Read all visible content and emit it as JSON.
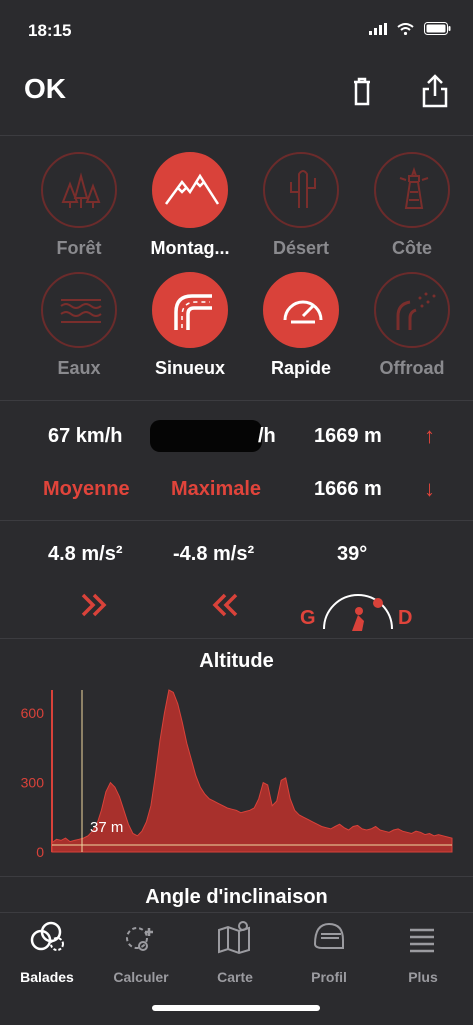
{
  "status": {
    "time": "18:15"
  },
  "header": {
    "title": "OK"
  },
  "categories": [
    {
      "label": "Forêt",
      "icon": "trees-icon",
      "active": false
    },
    {
      "label": "Montag...",
      "icon": "mountain-icon",
      "active": true
    },
    {
      "label": "Désert",
      "icon": "cactus-icon",
      "active": false
    },
    {
      "label": "Côte",
      "icon": "lighthouse-icon",
      "active": false
    },
    {
      "label": "Eaux",
      "icon": "waves-icon",
      "active": false
    },
    {
      "label": "Sinueux",
      "icon": "winding-road-icon",
      "active": true
    },
    {
      "label": "Rapide",
      "icon": "speedometer-icon",
      "active": true
    },
    {
      "label": "Offroad",
      "icon": "offroad-icon",
      "active": false
    }
  ],
  "stats": {
    "avg_speed": "67 km/h",
    "max_speed_suffix": "/h",
    "altitude_max": "1669 m",
    "avg_label": "Moyenne",
    "max_label": "Maximale",
    "altitude_min": "1666 m",
    "accel": "4.8 m/s²",
    "decel": "-4.8 m/s²",
    "lean_angle": "39°",
    "lean_left": "G",
    "lean_right": "D"
  },
  "altitude_section": {
    "title": "Altitude",
    "marker_label": "37 m"
  },
  "lean_section": {
    "title": "Angle d'inclinaison"
  },
  "chart_data": {
    "type": "area",
    "title": "Altitude",
    "yticks": [
      0,
      300,
      600
    ],
    "ylim": [
      0,
      700
    ],
    "series": [
      {
        "values": [
          40,
          55,
          50,
          60,
          45,
          50,
          55,
          60,
          70,
          90,
          120,
          180,
          260,
          300,
          280,
          240,
          180,
          120,
          80,
          70,
          90,
          130,
          200,
          330,
          480,
          600,
          700,
          690,
          640,
          560,
          470,
          400,
          330,
          280,
          250,
          230,
          220,
          210,
          200,
          190,
          185,
          180,
          170,
          175,
          180,
          190,
          230,
          300,
          290,
          200,
          220,
          310,
          320,
          230,
          180,
          160,
          150,
          140,
          130,
          120,
          110,
          105,
          100,
          110,
          120,
          105,
          95,
          110,
          115,
          100,
          95,
          100,
          110,
          95,
          90,
          85,
          95,
          100,
          90,
          85,
          80,
          90,
          85,
          75,
          80,
          70,
          75,
          70,
          65,
          60
        ]
      }
    ]
  },
  "tabs": [
    {
      "label": "Balades",
      "icon": "balades-icon",
      "active": true
    },
    {
      "label": "Calculer",
      "icon": "calculate-icon",
      "active": false
    },
    {
      "label": "Carte",
      "icon": "map-icon",
      "active": false
    },
    {
      "label": "Profil",
      "icon": "helmet-icon",
      "active": false
    },
    {
      "label": "Plus",
      "icon": "menu-icon",
      "active": false
    }
  ]
}
